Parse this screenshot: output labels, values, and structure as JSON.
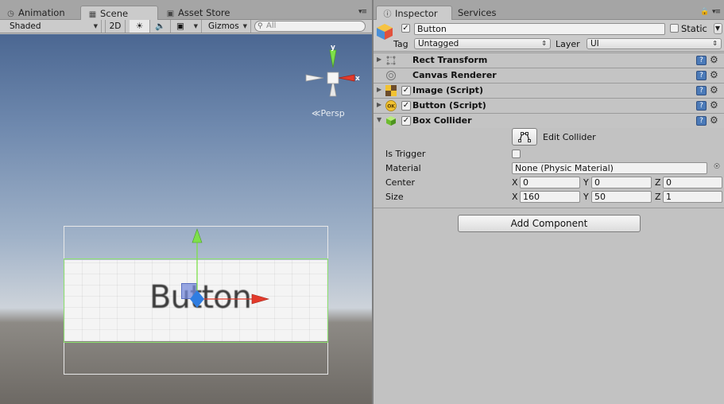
{
  "scene_panel": {
    "tabs": [
      {
        "label": "Animation",
        "icon": "clock-icon",
        "active": false
      },
      {
        "label": "Scene",
        "icon": "grid-icon",
        "active": true
      },
      {
        "label": "Asset Store",
        "icon": "store-icon",
        "active": false
      }
    ],
    "toolbar": {
      "draw_mode": "Shaded",
      "mode_2d": "2D",
      "gizmos": "Gizmos",
      "search_placeholder": "All"
    },
    "gizmo": {
      "y_label": "y",
      "x_label": "x",
      "projection": "Persp"
    },
    "world_button_text": "Button"
  },
  "inspector": {
    "tabs": [
      {
        "label": "Inspector",
        "icon": "info-icon",
        "active": true
      },
      {
        "label": "Services",
        "active": false
      }
    ],
    "object": {
      "active": true,
      "name": "Button",
      "static_label": "Static",
      "static_checked": false,
      "tag_label": "Tag",
      "tag_value": "Untagged",
      "layer_label": "Layer",
      "layer_value": "UI"
    },
    "components": [
      {
        "name": "Rect Transform",
        "icon": "rect-transform-icon",
        "has_checkbox": false,
        "expanded": false
      },
      {
        "name": "Canvas Renderer",
        "icon": "canvas-renderer-icon",
        "has_checkbox": false,
        "expanded": false
      },
      {
        "name": "Image (Script)",
        "icon": "image-script-icon",
        "has_checkbox": true,
        "checked": true,
        "expanded": false
      },
      {
        "name": "Button (Script)",
        "icon": "button-script-icon",
        "has_checkbox": true,
        "checked": true,
        "expanded": false
      },
      {
        "name": "Box Collider",
        "icon": "box-collider-icon",
        "has_checkbox": true,
        "checked": true,
        "expanded": true
      }
    ],
    "box_collider": {
      "edit_collider_label": "Edit Collider",
      "is_trigger_label": "Is Trigger",
      "is_trigger": false,
      "material_label": "Material",
      "material_value": "None (Physic Material)",
      "center_label": "Center",
      "center": {
        "x": "0",
        "y": "0",
        "z": "0"
      },
      "size_label": "Size",
      "size": {
        "x": "160",
        "y": "50",
        "z": "1"
      }
    },
    "add_component_label": "Add Component"
  },
  "colors": {
    "axis_y": "#7ee04a",
    "axis_x": "#e33a2b",
    "axis_z": "#2f7de1",
    "collider_outline": "#8de36f"
  }
}
